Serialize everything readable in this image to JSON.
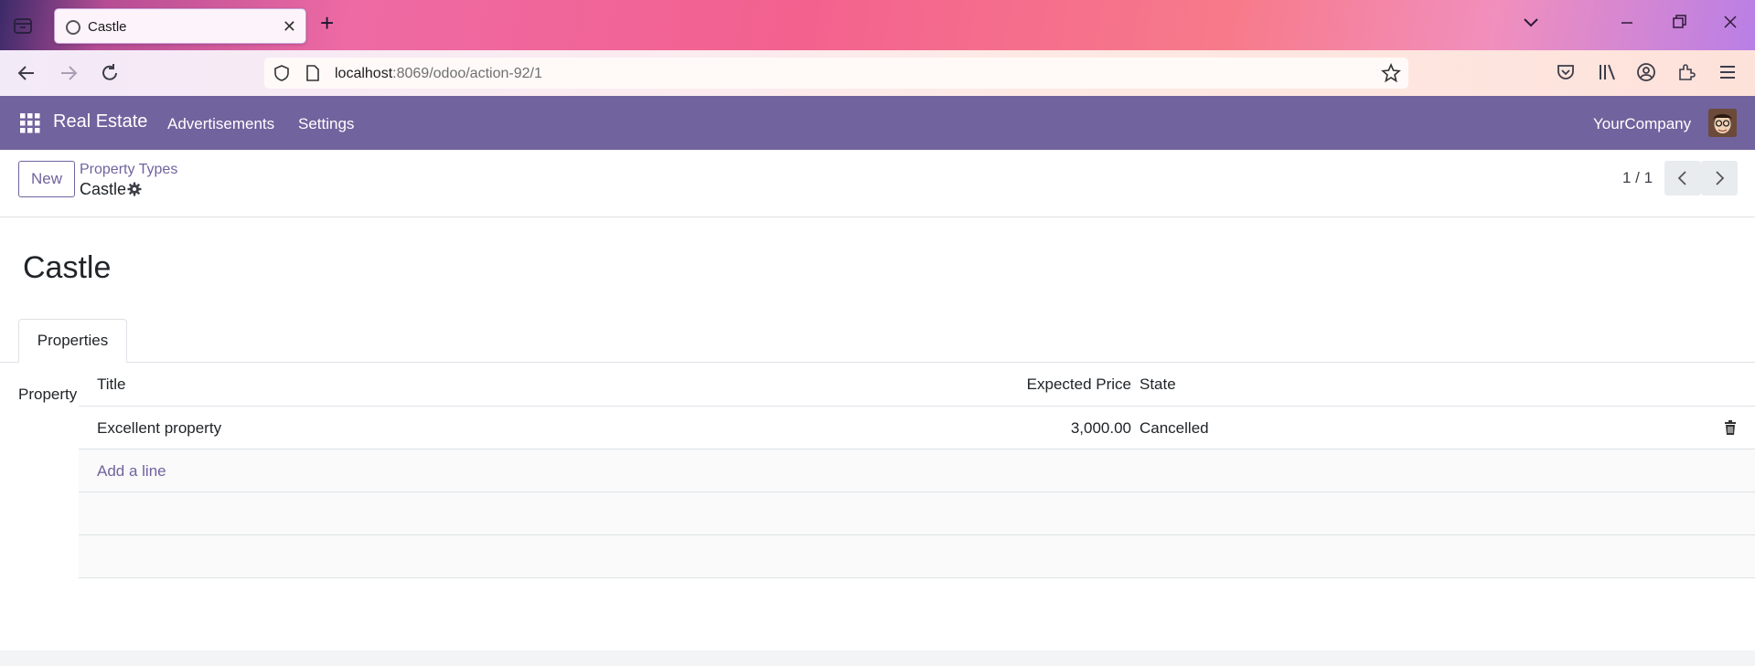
{
  "browser": {
    "tab_title": "Castle",
    "url_host": "localhost",
    "url_rest": ":8069/odoo/action-92/1"
  },
  "app": {
    "brand": "Real Estate",
    "menu": [
      "Advertisements",
      "Settings"
    ],
    "company": "YourCompany",
    "accent_color": "#71639e"
  },
  "control": {
    "new_label": "New",
    "breadcrumb_parent": "Property Types",
    "breadcrumb_current": "Castle",
    "pager": "1 / 1"
  },
  "form": {
    "title": "Castle",
    "tab": "Properties",
    "field_label": "Property",
    "columns": {
      "title": "Title",
      "price": "Expected Price",
      "state": "State"
    },
    "rows": [
      {
        "title": "Excellent property",
        "price": "3,000.00",
        "state": "Cancelled"
      }
    ],
    "add_line": "Add a line"
  }
}
